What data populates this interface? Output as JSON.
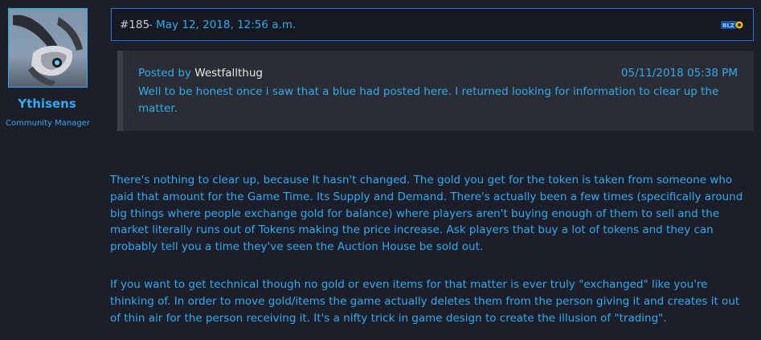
{
  "author": {
    "username": "Ythisens",
    "role": "Community Manager"
  },
  "post": {
    "number": "#185",
    "date": " - May 12, 2018, 12:56 a.m.",
    "badge_icon": "blizzard-icon"
  },
  "quote": {
    "posted_by_label": "Posted by ",
    "author": "Westfallthug",
    "timestamp": "05/11/2018 05:38 PM",
    "text": "Well to be honest once i saw that a blue had posted here. I returned looking for information to clear up the matter."
  },
  "body": {
    "paragraphs": [
      "There's nothing to clear up, because It hasn't changed. The gold you get for the token is taken from someone who paid that amount for the Game Time. Its Supply and Demand. There's actually been a few times (specifically around big things where people exchange gold for balance) where players aren't buying enough of them to sell and the market literally runs out of Tokens making the price increase. Ask players that buy a lot of tokens and they can probably tell you a time they've seen the Auction House be sold out.",
      "If you want to get technical though no gold or even items for that matter is ever truly \"exchanged\" like you're thinking of. In order to move gold/items the game actually deletes them from the person giving it and creates it out of thin air for the person receiving it. It's a nifty trick in game design to create the illusion of \"trading\"."
    ]
  },
  "colors": {
    "background": "#1c1f29",
    "accent": "#33aaf0",
    "header_border": "#2a78c8",
    "quote_background": "#2a2d33"
  }
}
